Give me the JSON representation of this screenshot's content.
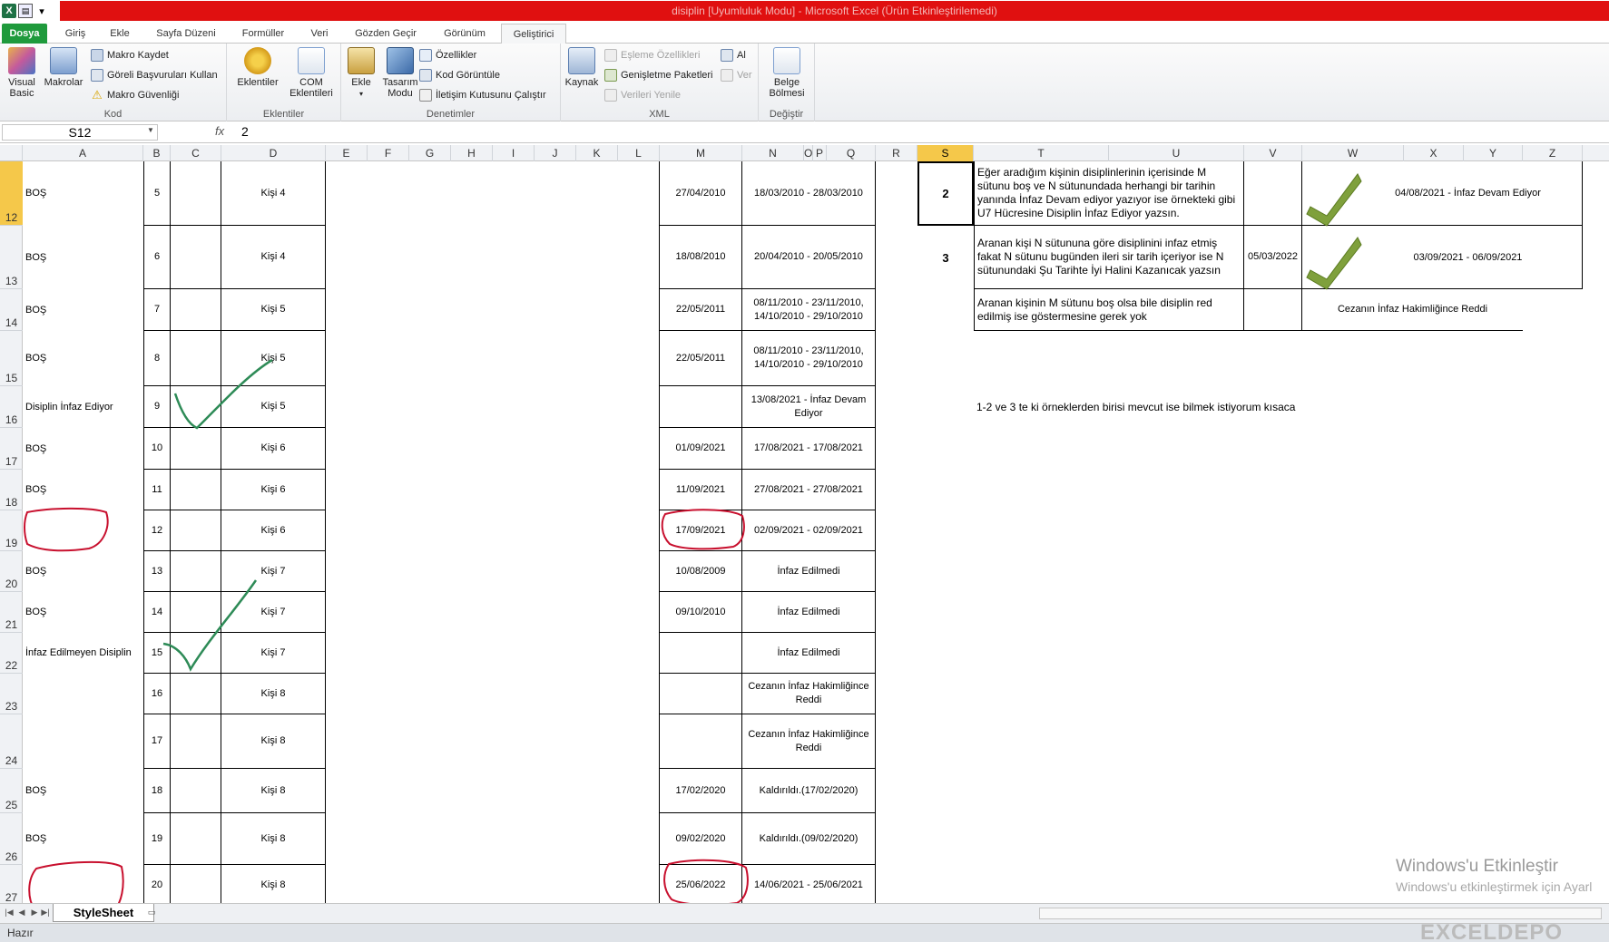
{
  "window": {
    "title": "disiplin  [Uyumluluk Modu]  -  Microsoft Excel (Ürün Etkinleştirilemedi)"
  },
  "tabs": [
    "Dosya",
    "Giriş",
    "Ekle",
    "Sayfa Düzeni",
    "Formüller",
    "Veri",
    "Gözden Geçir",
    "Görünüm",
    "Geliştirici"
  ],
  "ribbon": {
    "kod": {
      "visual_basic": "Visual Basic",
      "makrolar": "Makrolar",
      "makro_kaydet": "Makro Kaydet",
      "goreli": "Göreli Başvuruları Kullan",
      "guvenlik": "Makro Güvenliği",
      "label": "Kod"
    },
    "eklentiler": {
      "eklentiler": "Eklentiler",
      "com": "COM Eklentileri",
      "label": "Eklentiler"
    },
    "denetimler": {
      "ekle": "Ekle",
      "tasarim": "Tasarım Modu",
      "ozellikler": "Özellikler",
      "kod_goruntule": "Kod Görüntüle",
      "iletisim": "İletişim Kutusunu Çalıştır",
      "label": "Denetimler"
    },
    "xml": {
      "kaynak": "Kaynak",
      "esleme": "Eşleme Özellikleri",
      "genisletme": "Genişletme Paketleri",
      "yenile": "Verileri Yenile",
      "al": "Al",
      "ver": "Ver",
      "label": "XML"
    },
    "degistir": {
      "belge": "Belge Bölmesi",
      "label": "Değiştir"
    }
  },
  "formula": {
    "name_box": "S12",
    "fx": "fx",
    "value": "2"
  },
  "columns": [
    "A",
    "B",
    "C",
    "D",
    "E",
    "F",
    "G",
    "H",
    "I",
    "J",
    "K",
    "L",
    "M",
    "N",
    "O",
    "P",
    "Q",
    "R",
    "S",
    "T",
    "U",
    "V",
    "W",
    "X",
    "Y",
    "Z"
  ],
  "rows": [
    {
      "n": "12",
      "a": "BOŞ",
      "b": "5",
      "d": "Kişi 4",
      "m": "27/04/2010",
      "nq": "18/03/2010 - 28/03/2010"
    },
    {
      "n": "13",
      "a": "BOŞ",
      "b": "6",
      "d": "Kişi 4",
      "m": "18/08/2010",
      "nq": "20/04/2010 - 20/05/2010"
    },
    {
      "n": "14",
      "a": "BOŞ",
      "b": "7",
      "d": "Kişi 5",
      "m": "22/05/2011",
      "nq": "08/11/2010 - 23/11/2010, 14/10/2010 - 29/10/2010"
    },
    {
      "n": "15",
      "a": "BOŞ",
      "b": "8",
      "d": "Kişi 5",
      "m": "22/05/2011",
      "nq": "08/11/2010 - 23/11/2010, 14/10/2010 - 29/10/2010"
    },
    {
      "n": "16",
      "a": "Disiplin İnfaz Ediyor",
      "b": "9",
      "d": "Kişi 5",
      "m": "",
      "nq": "13/08/2021 - İnfaz Devam Ediyor"
    },
    {
      "n": "17",
      "a": "BOŞ",
      "b": "10",
      "d": "Kişi 6",
      "m": "01/09/2021",
      "nq": "17/08/2021 - 17/08/2021"
    },
    {
      "n": "18",
      "a": "BOŞ",
      "b": "11",
      "d": "Kişi 6",
      "m": "11/09/2021",
      "nq": "27/08/2021 - 27/08/2021"
    },
    {
      "n": "19",
      "a": "",
      "b": "12",
      "d": "Kişi 6",
      "m": "17/09/2021",
      "nq": "02/09/2021 - 02/09/2021"
    },
    {
      "n": "20",
      "a": "BOŞ",
      "b": "13",
      "d": "Kişi 7",
      "m": "10/08/2009",
      "nq": "İnfaz Edilmedi"
    },
    {
      "n": "21",
      "a": "BOŞ",
      "b": "14",
      "d": "Kişi 7",
      "m": "09/10/2010",
      "nq": "İnfaz Edilmedi"
    },
    {
      "n": "22",
      "a": "İnfaz Edilmeyen Disiplin",
      "b": "15",
      "d": "Kişi 7",
      "m": "",
      "nq": "İnfaz Edilmedi"
    },
    {
      "n": "23",
      "a": "",
      "b": "16",
      "d": "Kişi 8",
      "m": "",
      "nq": "Cezanın İnfaz Hakimliğince Reddi"
    },
    {
      "n": "24",
      "a": "",
      "b": "17",
      "d": "Kişi 8",
      "m": "",
      "nq": "Cezanın İnfaz Hakimliğince Reddi"
    },
    {
      "n": "25",
      "a": "BOŞ",
      "b": "18",
      "d": "Kişi 8",
      "m": "17/02/2020",
      "nq": "Kaldırıldı.(17/02/2020)"
    },
    {
      "n": "26",
      "a": "BOŞ",
      "b": "19",
      "d": "Kişi 8",
      "m": "09/02/2020",
      "nq": "Kaldırıldı.(09/02/2020)"
    },
    {
      "n": "27",
      "a": "",
      "b": "20",
      "d": "Kişi 8",
      "m": "25/06/2022",
      "nq": "14/06/2021 - 25/06/2021"
    }
  ],
  "right": {
    "s12": "2",
    "s13": "3",
    "t12": "Eğer aradığım kişinin disiplinlerinin içerisinde M sütunu boş ve N sütunundada herhangi bir tarihin yanında İnfaz Devam ediyor yazıyor ise örnekteki gibi U7 Hücresine Disiplin İnfaz Ediyor yazsın.",
    "t13": "Aranan kişi N sütununa göre disiplinini infaz etmiş fakat N sütunu bugünden ileri sir tarih içeriyor ise N sütunundaki Şu Tarihte İyi Halini Kazanıcak yazsın",
    "v13": "05/03/2022",
    "x12": "04/08/2021 - İnfaz Devam Ediyor",
    "x13": "03/09/2021 - 06/09/2021",
    "t14": "Aranan kişinin M sütunu boş olsa bile disiplin red edilmiş ise göstermesine gerek yok",
    "x14": "Cezanın İnfaz Hakimliğince Reddi",
    "note": "1-2 ve 3 te ki örneklerden birisi mevcut ise bilmek istiyorum kısaca"
  },
  "sheet": {
    "tab": "StyleSheet"
  },
  "status": {
    "ready": "Hazır"
  },
  "watermark": {
    "line1": "Windows'u Etkinleştir",
    "line2": "Windows'u etkinleştirmek için Ayarl"
  },
  "brand": "EXCELDEPO",
  "colors": {
    "title_red": "#e01010",
    "file_green": "#1f9a3c",
    "selection": "#f5c84a",
    "annotation_red": "#c8102e",
    "annotation_green": "#2e8b57",
    "check_green": "#7fa03c"
  }
}
